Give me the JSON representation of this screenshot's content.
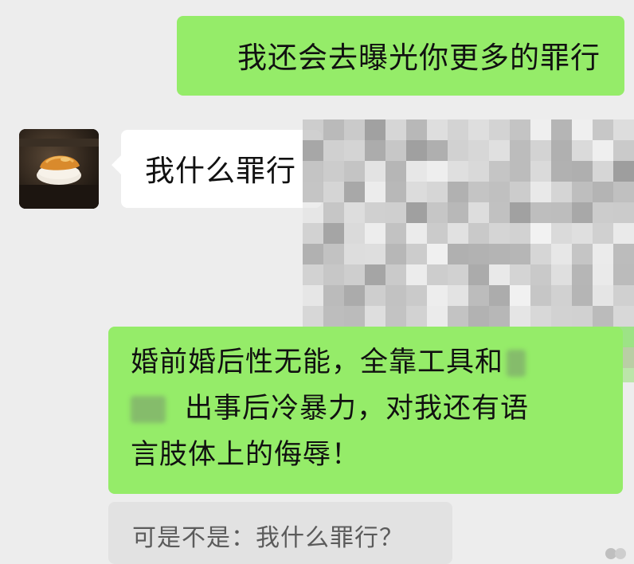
{
  "chat": {
    "messages": [
      {
        "sender": "self",
        "text": "我还会去曝光你更多的罪行"
      },
      {
        "sender": "other",
        "text": "我什么罪行"
      },
      {
        "sender": "self",
        "lines": [
          "婚前婚后性无能，全靠工具和",
          "出事后冷暴力，对我还有语",
          "言肢体上的侮辱！"
        ]
      }
    ],
    "quote": {
      "prefix": "可是不是：",
      "text": "我什么罪行？"
    }
  },
  "colors": {
    "background": "#ededed",
    "self_bubble": "#95ec69",
    "other_bubble": "#ffffff",
    "quote_bg": "#e2e2e2"
  },
  "icons": {
    "avatar": "sushi-avatar-photo",
    "watermark": "watermark-logo"
  }
}
